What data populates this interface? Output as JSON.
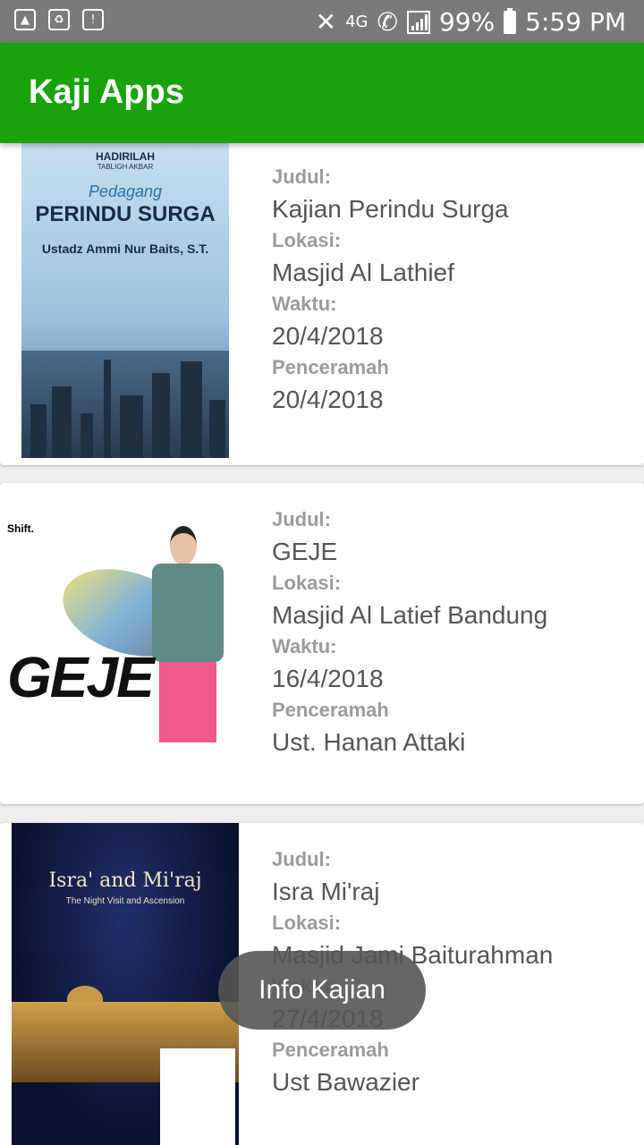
{
  "status_bar": {
    "battery_percent": "99%",
    "time": "5:59 PM",
    "network": "4G"
  },
  "app": {
    "title": "Kaji Apps"
  },
  "labels": {
    "judul": "Judul:",
    "lokasi": "Lokasi:",
    "waktu": "Waktu:",
    "penceramah": "Penceramah"
  },
  "events": [
    {
      "judul": "Kajian Perindu Surga",
      "lokasi": "Masjid Al Lathief",
      "waktu": "20/4/2018",
      "penceramah": "20/4/2018",
      "poster": {
        "line1": "HADIRILAH",
        "line2": "TABLIGH AKBAR",
        "theme": "Pedagang",
        "main": "PERINDU SURGA",
        "speaker": "Ustadz Ammi Nur Baits, S.T."
      }
    },
    {
      "judul": "GEJE",
      "lokasi": "Masjid Al Latief Bandung",
      "waktu": "16/4/2018",
      "penceramah": "Ust. Hanan Attaki",
      "poster": {
        "brand": "Shift.",
        "main": "GEJE"
      }
    },
    {
      "judul": "Isra Mi'raj",
      "lokasi": "Masjid Jami Baiturahman",
      "waktu": "27/4/2018",
      "penceramah": "Ust Bawazier",
      "poster": {
        "main": "Isra' and Mi'raj",
        "sub": "The Night Visit and Ascension"
      }
    }
  ],
  "toast": "Info Kajian"
}
